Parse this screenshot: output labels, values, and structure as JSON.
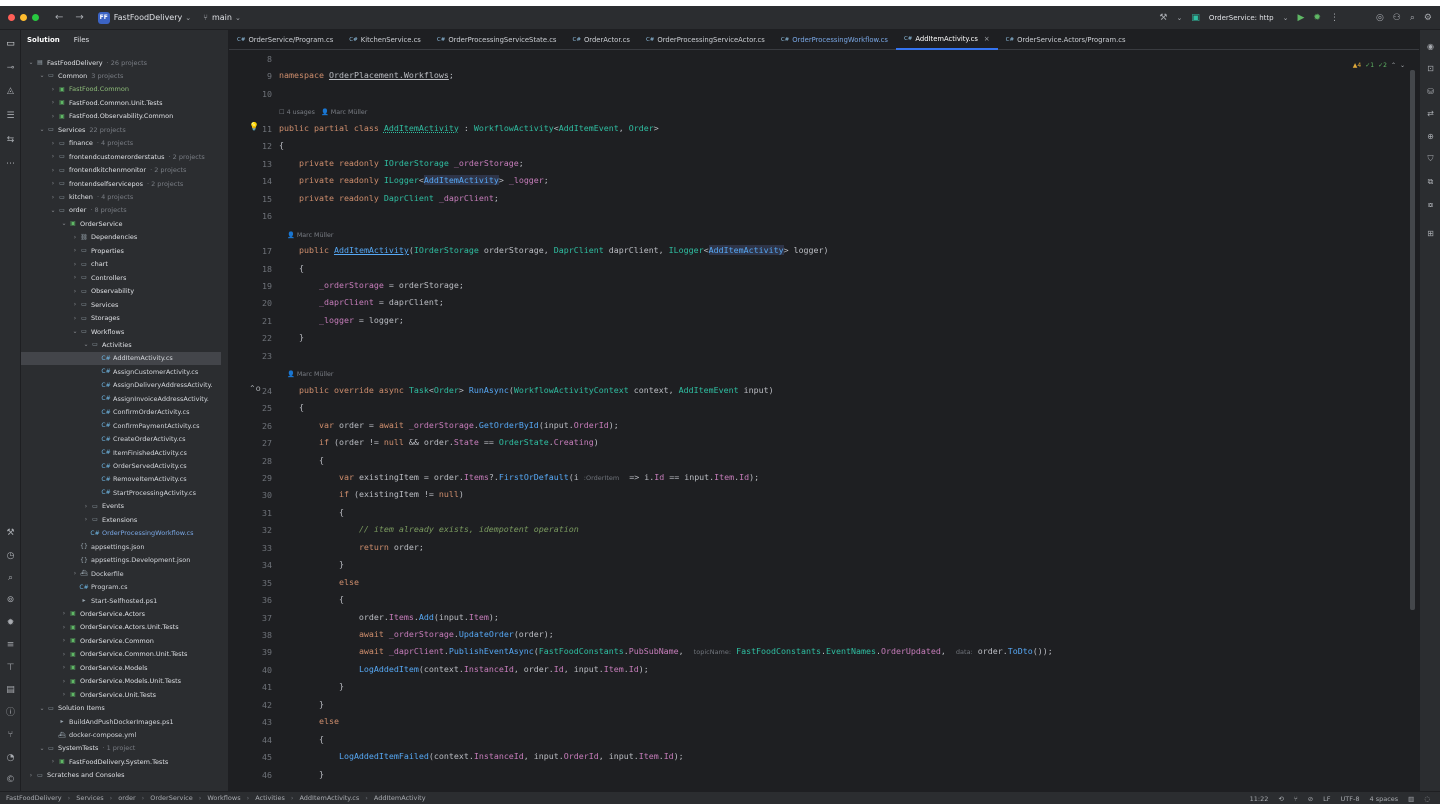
{
  "titlebar": {
    "project_badge": "FF",
    "project_name": "FastFoodDelivery",
    "branch": "main",
    "run_config": "OrderService: http"
  },
  "sidebar": {
    "tabs": [
      "Solution",
      "Files"
    ],
    "tree": [
      {
        "label": "FastFoodDelivery",
        "meta": "· 26 projects",
        "depth": 0,
        "arrow": "v",
        "icon": "sln",
        "kind": ""
      },
      {
        "label": "Common",
        "meta": "3 projects",
        "depth": 1,
        "arrow": "v",
        "icon": "folder",
        "kind": ""
      },
      {
        "label": "FastFood.Common",
        "meta": "",
        "depth": 2,
        "arrow": ">",
        "icon": "proj",
        "kind": "green"
      },
      {
        "label": "FastFood.Common.Unit.Tests",
        "meta": "",
        "depth": 2,
        "arrow": ">",
        "icon": "proj",
        "kind": ""
      },
      {
        "label": "FastFood.Observability.Common",
        "meta": "",
        "depth": 2,
        "arrow": ">",
        "icon": "proj",
        "kind": ""
      },
      {
        "label": "Services",
        "meta": "22 projects",
        "depth": 1,
        "arrow": "v",
        "icon": "folder",
        "kind": ""
      },
      {
        "label": "finance",
        "meta": "· 4 projects",
        "depth": 2,
        "arrow": ">",
        "icon": "folder",
        "kind": ""
      },
      {
        "label": "frontendcustomerorderstatus",
        "meta": "· 2 projects",
        "depth": 2,
        "arrow": ">",
        "icon": "folder",
        "kind": ""
      },
      {
        "label": "frontendkitchenmonitor",
        "meta": "· 2 projects",
        "depth": 2,
        "arrow": ">",
        "icon": "folder",
        "kind": ""
      },
      {
        "label": "frontendselfservicepos",
        "meta": "· 2 projects",
        "depth": 2,
        "arrow": ">",
        "icon": "folder",
        "kind": ""
      },
      {
        "label": "kitchen",
        "meta": "· 4 projects",
        "depth": 2,
        "arrow": ">",
        "icon": "folder",
        "kind": ""
      },
      {
        "label": "order",
        "meta": "· 8 projects",
        "depth": 2,
        "arrow": "v",
        "icon": "folder",
        "kind": ""
      },
      {
        "label": "OrderService",
        "meta": "",
        "depth": 3,
        "arrow": "v",
        "icon": "proj",
        "kind": ""
      },
      {
        "label": "Dependencies",
        "meta": "",
        "depth": 4,
        "arrow": ">",
        "icon": "dep",
        "kind": ""
      },
      {
        "label": "Properties",
        "meta": "",
        "depth": 4,
        "arrow": ">",
        "icon": "folder",
        "kind": ""
      },
      {
        "label": "chart",
        "meta": "",
        "depth": 4,
        "arrow": ">",
        "icon": "folder",
        "kind": ""
      },
      {
        "label": "Controllers",
        "meta": "",
        "depth": 4,
        "arrow": ">",
        "icon": "folder",
        "kind": ""
      },
      {
        "label": "Observability",
        "meta": "",
        "depth": 4,
        "arrow": ">",
        "icon": "folder",
        "kind": ""
      },
      {
        "label": "Services",
        "meta": "",
        "depth": 4,
        "arrow": ">",
        "icon": "folder",
        "kind": ""
      },
      {
        "label": "Storages",
        "meta": "",
        "depth": 4,
        "arrow": ">",
        "icon": "folder",
        "kind": ""
      },
      {
        "label": "Workflows",
        "meta": "",
        "depth": 4,
        "arrow": "v",
        "icon": "folder",
        "kind": ""
      },
      {
        "label": "Activities",
        "meta": "",
        "depth": 5,
        "arrow": "v",
        "icon": "folder",
        "kind": ""
      },
      {
        "label": "AddItemActivity.cs",
        "meta": "",
        "depth": 6,
        "arrow": "",
        "icon": "cs",
        "kind": "file",
        "selected": true
      },
      {
        "label": "AssignCustomerActivity.cs",
        "meta": "",
        "depth": 6,
        "arrow": "",
        "icon": "cs",
        "kind": "file"
      },
      {
        "label": "AssignDeliveryAddressActivity.",
        "meta": "",
        "depth": 6,
        "arrow": "",
        "icon": "cs",
        "kind": "file"
      },
      {
        "label": "AssignInvoiceAddressActivity.",
        "meta": "",
        "depth": 6,
        "arrow": "",
        "icon": "cs",
        "kind": "file"
      },
      {
        "label": "ConfirmOrderActivity.cs",
        "meta": "",
        "depth": 6,
        "arrow": "",
        "icon": "cs",
        "kind": "file"
      },
      {
        "label": "ConfirmPaymentActivity.cs",
        "meta": "",
        "depth": 6,
        "arrow": "",
        "icon": "cs",
        "kind": "file"
      },
      {
        "label": "CreateOrderActivity.cs",
        "meta": "",
        "depth": 6,
        "arrow": "",
        "icon": "cs",
        "kind": "file"
      },
      {
        "label": "ItemFinishedActivity.cs",
        "meta": "",
        "depth": 6,
        "arrow": "",
        "icon": "cs",
        "kind": "file"
      },
      {
        "label": "OrderServedActivity.cs",
        "meta": "",
        "depth": 6,
        "arrow": "",
        "icon": "cs",
        "kind": "file"
      },
      {
        "label": "RemoveItemActivity.cs",
        "meta": "",
        "depth": 6,
        "arrow": "",
        "icon": "cs",
        "kind": "file"
      },
      {
        "label": "StartProcessingActivity.cs",
        "meta": "",
        "depth": 6,
        "arrow": "",
        "icon": "cs",
        "kind": "file"
      },
      {
        "label": "Events",
        "meta": "",
        "depth": 5,
        "arrow": ">",
        "icon": "folder",
        "kind": ""
      },
      {
        "label": "Extensions",
        "meta": "",
        "depth": 5,
        "arrow": ">",
        "icon": "folder",
        "kind": ""
      },
      {
        "label": "OrderProcessingWorkflow.cs",
        "meta": "",
        "depth": 5,
        "arrow": "",
        "icon": "cs",
        "kind": "linkish"
      },
      {
        "label": "appsettings.json",
        "meta": "",
        "depth": 4,
        "arrow": "",
        "icon": "json",
        "kind": "file"
      },
      {
        "label": "appsettings.Development.json",
        "meta": "",
        "depth": 4,
        "arrow": "",
        "icon": "json",
        "kind": "file"
      },
      {
        "label": "Dockerfile",
        "meta": "",
        "depth": 4,
        "arrow": ">",
        "icon": "docker",
        "kind": "file"
      },
      {
        "label": "Program.cs",
        "meta": "",
        "depth": 4,
        "arrow": "",
        "icon": "cs",
        "kind": "file"
      },
      {
        "label": "Start-Selfhosted.ps1",
        "meta": "",
        "depth": 4,
        "arrow": "",
        "icon": "ps",
        "kind": "file"
      },
      {
        "label": "OrderService.Actors",
        "meta": "",
        "depth": 3,
        "arrow": ">",
        "icon": "proj",
        "kind": ""
      },
      {
        "label": "OrderService.Actors.Unit.Tests",
        "meta": "",
        "depth": 3,
        "arrow": ">",
        "icon": "proj",
        "kind": ""
      },
      {
        "label": "OrderService.Common",
        "meta": "",
        "depth": 3,
        "arrow": ">",
        "icon": "proj",
        "kind": ""
      },
      {
        "label": "OrderService.Common.Unit.Tests",
        "meta": "",
        "depth": 3,
        "arrow": ">",
        "icon": "proj",
        "kind": ""
      },
      {
        "label": "OrderService.Models",
        "meta": "",
        "depth": 3,
        "arrow": ">",
        "icon": "proj",
        "kind": ""
      },
      {
        "label": "OrderService.Models.Unit.Tests",
        "meta": "",
        "depth": 3,
        "arrow": ">",
        "icon": "proj",
        "kind": ""
      },
      {
        "label": "OrderService.Unit.Tests",
        "meta": "",
        "depth": 3,
        "arrow": ">",
        "icon": "proj",
        "kind": ""
      },
      {
        "label": "Solution Items",
        "meta": "",
        "depth": 1,
        "arrow": "v",
        "icon": "folder",
        "kind": ""
      },
      {
        "label": "BuildAndPushDockerImages.ps1",
        "meta": "",
        "depth": 2,
        "arrow": "",
        "icon": "ps",
        "kind": "file"
      },
      {
        "label": "docker-compose.yml",
        "meta": "",
        "depth": 2,
        "arrow": "",
        "icon": "docker",
        "kind": "file"
      },
      {
        "label": "SystemTests",
        "meta": "· 1 project",
        "depth": 1,
        "arrow": "v",
        "icon": "folder",
        "kind": ""
      },
      {
        "label": "FastFoodDelivery.System.Tests",
        "meta": "",
        "depth": 2,
        "arrow": ">",
        "icon": "proj",
        "kind": ""
      },
      {
        "label": "Scratches and Consoles",
        "meta": "",
        "depth": 0,
        "arrow": ">",
        "icon": "folder",
        "kind": ""
      }
    ]
  },
  "tabs": [
    {
      "label": "OrderService/Program.cs",
      "active": false,
      "blue": false
    },
    {
      "label": "KitchenService.cs",
      "active": false,
      "blue": false
    },
    {
      "label": "OrderProcessingServiceState.cs",
      "active": false,
      "blue": false
    },
    {
      "label": "OrderActor.cs",
      "active": false,
      "blue": false
    },
    {
      "label": "OrderProcessingServiceActor.cs",
      "active": false,
      "blue": false
    },
    {
      "label": "OrderProcessingWorkflow.cs",
      "active": false,
      "blue": true
    },
    {
      "label": "AddItemActivity.cs",
      "active": true,
      "blue": false
    },
    {
      "label": "OrderService.Actors/Program.cs",
      "active": false,
      "blue": false
    }
  ],
  "inspections": {
    "warnings": "▲4",
    "weak": "✓1",
    "typos": "✓2"
  },
  "code": {
    "lines": [
      {
        "n": "8",
        "html": ""
      },
      {
        "n": "9",
        "html": "<span class=\"kw\">namespace</span> <span class=\"ns\">OrderPlacement.Workflows</span>;"
      },
      {
        "n": "10",
        "html": ""
      },
      {
        "hint": "☐ 4 usages   👤 Marc Müller"
      },
      {
        "n": "11",
        "html": "<span class=\"kw\">public partial class</span> <span class=\"ty\" style=\"text-decoration:underline dotted\">AddItemActivity</span> : <span class=\"ty\">WorkflowActivity</span>&lt;<span class=\"ty\">AddItemEvent</span>, <span class=\"ty\">Order</span>&gt;"
      },
      {
        "n": "12",
        "html": "{"
      },
      {
        "n": "13",
        "html": "    <span class=\"kw\">private readonly</span> <span class=\"ty\">IOrderStorage</span> <span class=\"pr\">_orderStorage</span>;"
      },
      {
        "n": "14",
        "html": "    <span class=\"kw\">private readonly</span> <span class=\"ty\">ILogger</span>&lt;<span class=\"hl\">AddItemActivity</span>&gt; <span class=\"pr\">_logger</span>;"
      },
      {
        "n": "15",
        "html": "    <span class=\"kw\">private readonly</span> <span class=\"ty\">DaprClient</span> <span class=\"pr\">_daprClient</span>;"
      },
      {
        "n": "16",
        "html": ""
      },
      {
        "hint": "    👤 Marc Müller"
      },
      {
        "n": "17",
        "html": "    <span class=\"kw\">public</span> <span class=\"fn\" style=\"text-decoration:underline\">AddItemActivity</span>(<span class=\"ty\">IOrderStorage</span> orderStorage, <span class=\"ty\">DaprClient</span> daprClient, <span class=\"ty\">ILogger</span>&lt;<span class=\"hl\">AddItemActivity</span>&gt; logger)"
      },
      {
        "n": "18",
        "html": "    {"
      },
      {
        "n": "19",
        "html": "        <span class=\"pr\">_orderStorage</span> = orderStorage;"
      },
      {
        "n": "20",
        "html": "        <span class=\"pr\">_daprClient</span> = daprClient;"
      },
      {
        "n": "21",
        "html": "        <span class=\"pr\">_logger</span> = logger;"
      },
      {
        "n": "22",
        "html": "    }"
      },
      {
        "n": "23",
        "html": ""
      },
      {
        "hint": "    👤 Marc Müller"
      },
      {
        "n": "24",
        "html": "    <span class=\"kw\">public override async</span> <span class=\"ty\">Task</span>&lt;<span class=\"ty\">Order</span>&gt; <span class=\"fn\">RunAsync</span>(<span class=\"ty\">WorkflowActivityContext</span> context, <span class=\"ty\">AddItemEvent</span> input)"
      },
      {
        "n": "25",
        "html": "    {"
      },
      {
        "n": "26",
        "html": "        <span class=\"kw\">var</span> order = <span class=\"kw\">await</span> <span class=\"pr\">_orderStorage</span>.<span class=\"fn\">GetOrderById</span>(input.<span class=\"pr\">OrderId</span>);"
      },
      {
        "n": "27",
        "html": "        <span class=\"kw\">if</span> (order != <span class=\"kw\">null</span> &amp;&amp; order.<span class=\"pr\">State</span> == <span class=\"ty\">OrderState</span>.<span class=\"pr\">Creating</span>)"
      },
      {
        "n": "28",
        "html": "        {"
      },
      {
        "n": "29",
        "html": "            <span class=\"kw\">var</span> existingItem = order.<span class=\"pr\">Items</span>?.<span class=\"fn\">FirstOrDefault</span>(i <span class=\"ih\">:OrderItem</span>  =&gt; i.<span class=\"pr\">Id</span> == input.<span class=\"pr\">Item</span>.<span class=\"pr\">Id</span>);"
      },
      {
        "n": "30",
        "html": "            <span class=\"kw\">if</span> (existingItem != <span class=\"kw\">null</span>)"
      },
      {
        "n": "31",
        "html": "            {"
      },
      {
        "n": "32",
        "html": "                <span class=\"cm\">// item already exists, idempotent operation</span>"
      },
      {
        "n": "33",
        "html": "                <span class=\"kw\">return</span> order;"
      },
      {
        "n": "34",
        "html": "            }"
      },
      {
        "n": "35",
        "html": "            <span class=\"kw\">else</span>"
      },
      {
        "n": "36",
        "html": "            {"
      },
      {
        "n": "37",
        "html": "                order.<span class=\"pr\">Items</span>.<span class=\"fn\">Add</span>(input.<span class=\"pr\">Item</span>);"
      },
      {
        "n": "38",
        "html": "                <span class=\"kw\">await</span> <span class=\"pr\">_orderStorage</span>.<span class=\"fn\">UpdateOrder</span>(order);"
      },
      {
        "n": "39",
        "html": "                <span class=\"kw\">await</span> <span class=\"pr\">_daprClient</span>.<span class=\"fn\">PublishEventAsync</span>(<span class=\"ty\">FastFoodConstants</span>.<span class=\"pr\">PubSubName</span>,  <span class=\"ih\">topicName:</span> <span class=\"ty\">FastFoodConstants</span>.<span class=\"ty\">EventNames</span>.<span class=\"pr\">OrderUpdated</span>,  <span class=\"ih\">data:</span> order.<span class=\"fn\">ToDto</span>());"
      },
      {
        "n": "40",
        "html": "                <span class=\"fn\">LogAddedItem</span>(context.<span class=\"pr\">InstanceId</span>, order.<span class=\"pr\">Id</span>, input.<span class=\"pr\">Item</span>.<span class=\"pr\">Id</span>);"
      },
      {
        "n": "41",
        "html": "            }"
      },
      {
        "n": "42",
        "html": "        }"
      },
      {
        "n": "43",
        "html": "        <span class=\"kw\">else</span>"
      },
      {
        "n": "44",
        "html": "        {"
      },
      {
        "n": "45",
        "html": "            <span class=\"fn\">LogAddedItemFailed</span>(context.<span class=\"pr\">InstanceId</span>, input.<span class=\"pr\">OrderId</span>, input.<span class=\"pr\">Item</span>.<span class=\"pr\">Id</span>);"
      },
      {
        "n": "46",
        "html": "        }"
      }
    ]
  },
  "statusbar": {
    "breadcrumbs": [
      "FastFoodDelivery",
      "Services",
      "order",
      "OrderService",
      "Workflows",
      "Activities",
      "AddItemActivity.cs",
      "AddItemActivity"
    ],
    "position": "11:22",
    "line_ending": "LF",
    "encoding": "UTF-8",
    "indent": "4 spaces"
  }
}
